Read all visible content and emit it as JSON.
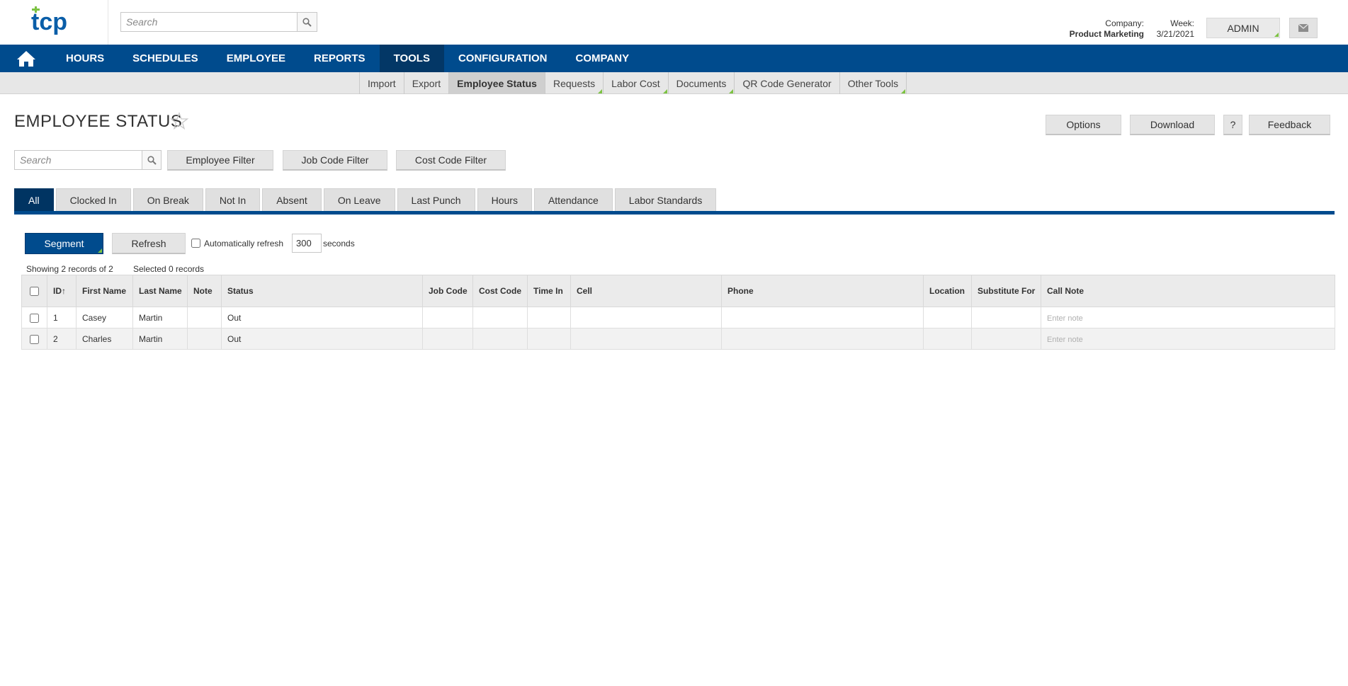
{
  "header": {
    "search_placeholder": "Search",
    "company_label": "Company:",
    "company_value": "Product Marketing",
    "week_label": "Week:",
    "week_value": "3/21/2021",
    "user_button": "ADMIN"
  },
  "main_nav": {
    "items": [
      {
        "label": "HOURS"
      },
      {
        "label": "SCHEDULES"
      },
      {
        "label": "EMPLOYEE"
      },
      {
        "label": "REPORTS"
      },
      {
        "label": "TOOLS",
        "active": true
      },
      {
        "label": "CONFIGURATION"
      },
      {
        "label": "COMPANY"
      }
    ]
  },
  "sub_nav": {
    "items": [
      {
        "label": "Import"
      },
      {
        "label": "Export"
      },
      {
        "label": "Employee Status",
        "active": true
      },
      {
        "label": "Requests",
        "has_menu": true
      },
      {
        "label": "Labor Cost",
        "has_menu": true
      },
      {
        "label": "Documents",
        "has_menu": true
      },
      {
        "label": "QR Code Generator"
      },
      {
        "label": "Other Tools",
        "has_menu": true
      }
    ]
  },
  "page": {
    "title": "EMPLOYEE STATUS",
    "actions": {
      "options": "Options",
      "download": "Download",
      "help": "?",
      "feedback": "Feedback"
    },
    "filter": {
      "search_placeholder": "Search",
      "employee_filter": "Employee Filter",
      "job_code_filter": "Job Code Filter",
      "cost_code_filter": "Cost Code Filter"
    },
    "tabs": [
      {
        "label": "All",
        "active": true
      },
      {
        "label": "Clocked In"
      },
      {
        "label": "On Break"
      },
      {
        "label": "Not In"
      },
      {
        "label": "Absent"
      },
      {
        "label": "On Leave"
      },
      {
        "label": "Last Punch"
      },
      {
        "label": "Hours"
      },
      {
        "label": "Attendance"
      },
      {
        "label": "Labor Standards"
      }
    ],
    "toolbar": {
      "segment": "Segment",
      "refresh": "Refresh",
      "auto_refresh_label": "Automatically refresh",
      "auto_refresh_value": "300",
      "seconds_label": "seconds"
    },
    "records": {
      "showing": "Showing 2 records of 2",
      "selected": "Selected 0 records"
    }
  },
  "table": {
    "columns": [
      "ID↑",
      "First Name",
      "Last Name",
      "Note",
      "Status",
      "Job Code",
      "Cost Code",
      "Time In",
      "Cell",
      "Phone",
      "Location",
      "Substitute For",
      "Call Note"
    ],
    "rows": [
      {
        "id": "1",
        "first": "Casey",
        "last": "Martin",
        "note": "",
        "status": "Out",
        "job_code": "",
        "cost_code": "",
        "time_in": "",
        "cell": "",
        "phone": "",
        "location": "",
        "substitute": ""
      },
      {
        "id": "2",
        "first": "Charles",
        "last": "Martin",
        "note": "",
        "status": "Out",
        "job_code": "",
        "cost_code": "",
        "time_in": "",
        "cell": "",
        "phone": "",
        "location": "",
        "substitute": ""
      }
    ],
    "call_note_placeholder": "Enter note"
  },
  "colors": {
    "brand_blue": "#004b8d",
    "active_nav": "#033766",
    "active_tab": "#003462",
    "accent_green": "#7cc242"
  }
}
